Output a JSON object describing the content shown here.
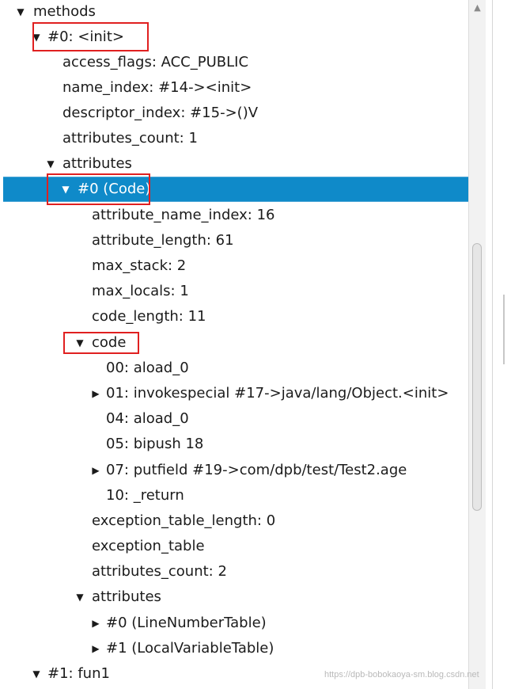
{
  "tree": {
    "methods": "methods",
    "m0": "#0: <init>",
    "access_flags": "access_flags: ACC_PUBLIC",
    "name_index": "name_index: #14-><init>",
    "descriptor_index": "descriptor_index: #15->()V",
    "attributes_count": "attributes_count: 1",
    "attributes": "attributes",
    "code_attr": "#0 (Code)",
    "attribute_name_index": "attribute_name_index: 16",
    "attribute_length": "attribute_length: 61",
    "max_stack": "max_stack: 2",
    "max_locals": "max_locals: 1",
    "code_length": "code_length: 11",
    "code": "code",
    "op00": "00: aload_0",
    "op01": "01: invokespecial #17->java/lang/Object.<init>",
    "op04": "04: aload_0",
    "op05": "05: bipush 18",
    "op07": "07: putfield #19->com/dpb/test/Test2.age",
    "op10": "10: _return",
    "exception_table_length": "exception_table_length: 0",
    "exception_table": "exception_table",
    "code_attributes_count": "attributes_count: 2",
    "code_attributes": "attributes",
    "line_number_table": "#0 (LineNumberTable)",
    "local_variable_table": "#1 (LocalVariableTable)",
    "m1": "#1: fun1"
  },
  "icons": {
    "expanded": "triangle-down",
    "collapsed": "triangle-right"
  },
  "colors": {
    "selection": "#0f8ac9",
    "highlight_box": "#e02020"
  },
  "watermark": "https://dpb-bobokaoya-sm.blog.csdn.net"
}
